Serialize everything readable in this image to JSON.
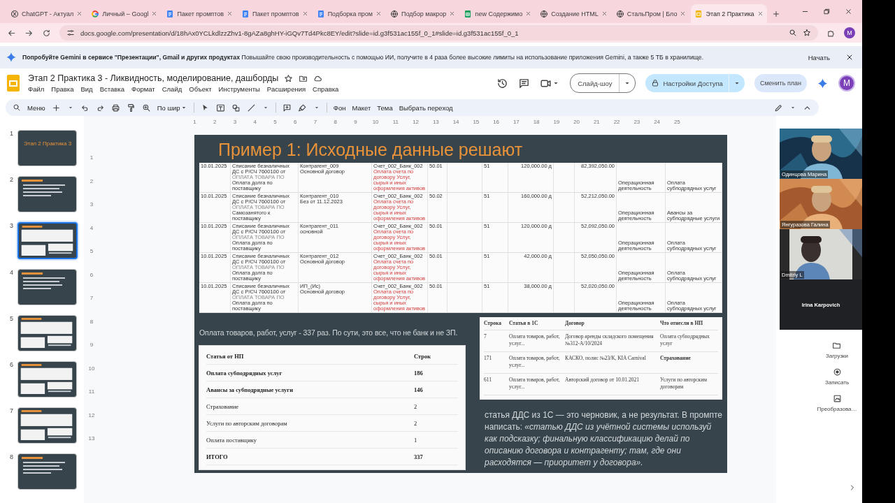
{
  "browser": {
    "tabs": [
      {
        "title": "ChatGPT - Актуал",
        "selected": false
      },
      {
        "title": "Личный – Googl",
        "selected": false
      },
      {
        "title": "Пакет промптов",
        "selected": false
      },
      {
        "title": "Пакет промптов",
        "selected": false
      },
      {
        "title": "Подборка пром",
        "selected": false
      },
      {
        "title": "Подбор макрор",
        "selected": false
      },
      {
        "title": "new Содержимо",
        "selected": false
      },
      {
        "title": "Создание HTML",
        "selected": false
      },
      {
        "title": "СтальПром | Бло",
        "selected": false
      },
      {
        "title": "Этап 2 Практика",
        "selected": true
      }
    ],
    "url": "docs.google.com/presentation/d/18hAx0YCLkdlzzZhv1-8gAZa8ghHY-iGQv7Td4Pkc8EY/edit?slide=id.g3f531ac155f_0_1#slide=id.g3f531ac155f_0_1",
    "profile": "M"
  },
  "banner": {
    "text": "**Попробуйте Gemini в сервисе \"Презентации\", Gmail и других продуктах** Повышайте свою производительность с помощью ИИ, получите в 4 раза более высокие лимиты на использование приложения Gemini, а также 5 ТБ в хранилище.",
    "action": "Начать"
  },
  "doc": {
    "title": "Этап 2 Практика 3 - Ликвидность, моделирование, дашборды",
    "menu": [
      "Файл",
      "Правка",
      "Вид",
      "Вставка",
      "Формат",
      "Слайд",
      "Объект",
      "Инструменты",
      "Расширения",
      "Справка"
    ],
    "slideshow": "Слайд-шоу",
    "share": "Настройки Доступа",
    "upgrade": "Сменить план",
    "avatar": "M"
  },
  "toolbar": {
    "search": "Меню",
    "zoom": "По шир",
    "actions": [
      "Фон",
      "Макет",
      "Тема",
      "Выбрать переход"
    ]
  },
  "ruler": {
    "horizontal": [
      "1",
      "2",
      "3",
      "4",
      "5",
      "6",
      "7",
      "8",
      "9",
      "10",
      "11",
      "12",
      "13",
      "14",
      "15",
      "16",
      "17",
      "18",
      "19",
      "20",
      "21",
      "22",
      "23",
      "24",
      "25"
    ],
    "vertical": [
      "1",
      "2",
      "3",
      "4",
      "5",
      "6",
      "7",
      "8",
      "9",
      "10",
      "11",
      "12",
      "13"
    ]
  },
  "thumbnails": [
    {
      "number": "1",
      "selected": false,
      "kind": "title",
      "title": "Этап 2 Практика 3"
    },
    {
      "number": "2",
      "selected": false,
      "kind": "bullets"
    },
    {
      "number": "3",
      "selected": true,
      "kind": "tables"
    },
    {
      "number": "4",
      "selected": false,
      "kind": "bullets"
    },
    {
      "number": "5",
      "selected": false,
      "kind": "tables"
    },
    {
      "number": "6",
      "selected": false,
      "kind": "tables"
    },
    {
      "number": "7",
      "selected": false,
      "kind": "tables"
    },
    {
      "number": "8",
      "selected": false,
      "kind": "bullets"
    }
  ],
  "slide": {
    "title": "Пример 1: Исходные данные решают",
    "source_rows": [
      {
        "date": "10.01.2025",
        "description": "Списание безналичных ДС с Р/СЧ 7600100 от",
        "note": "ОПЛАТА ТОВАРА ПО",
        "detail": "Оплата долга по поставщику",
        "counterparty": "Контрагент_009",
        "contract": "Основной договор",
        "account": "Счет_002_Банк_002",
        "purpose": "Оплата счета по договору Услуг, сырья и иных оформления активов",
        "debit": "50.01",
        "credit": "51",
        "amount": "120,000.00",
        "amount_mark": "д",
        "balance": "82,392,050.00",
        "activity": "Операционная деятельность",
        "article": "Оплата субподрядных услуг"
      },
      {
        "date": "10.01.2025",
        "description": "Списание безналичных ДС с Р/СЧ 7600100 от",
        "note": "ОПЛАТА ТОВАРА ПО",
        "detail": "Самозанятого к поставщику",
        "counterparty": "Контрагент_010",
        "contract": "Без от 11.12.2023",
        "account": "Счет_002_Банк_002",
        "purpose": "Оплата счета по договору Услуг, сырья и иных оформления активов",
        "debit": "50.02",
        "credit": "51",
        "amount": "160,000.00",
        "amount_mark": "д",
        "balance": "52,212,050.00",
        "activity": "Операционная деятельность",
        "article": "Авансы за субподрядные услуги"
      },
      {
        "date": "10.01.2025",
        "description": "Списание безналичных ДС с Р/СЧ 7600100 от",
        "note": "ОПЛАТА ТОВАРА ПО",
        "detail": "Оплата долга по поставщику",
        "counterparty": "Контрагент_011",
        "contract": "основной",
        "account": "Счет_002_Банк_002",
        "purpose": "Оплата счета по договору Услуг, сырья и иных оформления активов",
        "debit": "50.01",
        "credit": "51",
        "amount": "120,000.00",
        "amount_mark": "д",
        "balance": "52,092,050.00",
        "activity": "Операционная деятельность",
        "article": "Оплата субподрядных услуг"
      },
      {
        "date": "10.01.2025",
        "description": "Списание безналичных ДС с Р/СЧ 7600100 от",
        "note": "ОПЛАТА ТОВАРА ПО",
        "detail": "Оплата долга по поставщику",
        "counterparty": "Контрагент_012",
        "contract": "Основной договор",
        "account": "Счет_002_Банк_002",
        "purpose": "Оплата счета по договору Услуг, сырья и иных оформления активов",
        "debit": "50.01",
        "credit": "51",
        "amount": "42,000.00",
        "amount_mark": "д",
        "balance": "52,050,050.00",
        "activity": "Операционная деятельность",
        "article": "Оплата субподрядных услуг"
      },
      {
        "date": "10.01.2025",
        "description": "Списание безналичных ДС с Р/СЧ 7600100 от",
        "note": "ОПЛАТА ТОВАРА ПО",
        "detail": "Оплата долга по поставщику",
        "counterparty": "ИП_(Ис)",
        "contract": "Основной договор",
        "account": "Счет_002_Банк_002",
        "purpose": "Оплата счета по договору Услуг, сырья и иных оформления активов",
        "debit": "50.01",
        "credit": "51",
        "amount": "38,000.00",
        "amount_mark": "д",
        "balance": "52,020,050.00",
        "activity": "Операционная деятельность",
        "article": "Оплата субподрядных услуг"
      }
    ],
    "caption": "Оплата товаров, работ, услуг - 337 раз. По сути, это все, что не банк и не ЗП.",
    "summary_table": {
      "columns": [
        "Статья от НП",
        "Строк"
      ],
      "rows": [
        {
          "article": "Оплата субподрядных услуг",
          "count": "186",
          "bold": true
        },
        {
          "article": "Авансы за субподрядные услуги",
          "count": "146",
          "bold": true
        },
        {
          "article": "Страхование",
          "count": "2",
          "bold": false
        },
        {
          "article": "Услуги по авторским договорам",
          "count": "2",
          "bold": false
        },
        {
          "article": "Оплата поставщику",
          "count": "1",
          "bold": false
        },
        {
          "article": "ИТОГО",
          "count": "337",
          "bold": true
        }
      ]
    },
    "examples_table": {
      "columns": [
        "Строка",
        "Статья в 1С",
        "Договор",
        "Что отнесли в НП"
      ],
      "rows": [
        {
          "line": "7",
          "article": "Оплата товаров, работ, услуг...",
          "contract": "Договор аренды складского помещения №312-А/10/2024",
          "category": "Оплата субподрядных услуг",
          "bold": false
        },
        {
          "line": "171",
          "article": "Оплата товаров, работ, услуг...",
          "contract": "КАСКО, полис №23/К, KIA Carnival",
          "category": "Страхование",
          "bold": true
        },
        {
          "line": "611",
          "article": "Оплата товаров, работ, услуг...",
          "contract": "Авторский договор от 10.01.2021",
          "category": "Услуги по авторским договорам",
          "bold": false
        }
      ]
    },
    "note": "статья ДДС из 1С — это черновик, а не результат. В промпте написать: *«статью ДДС из учётной системы используй как подсказку; финальную классификацию делай по описанию договора и контрагенту; там, где они расходятся — приоритет у договора».*"
  },
  "participants": [
    {
      "name": "Одинцова Марина",
      "kind": "video"
    },
    {
      "name": "Янгуразова Галина",
      "kind": "video"
    },
    {
      "name": "Dmitriy L",
      "kind": "video"
    },
    {
      "name": "Irina Karpovich",
      "kind": "name"
    }
  ],
  "side_actions": [
    "Загрузки",
    "Записать",
    "Преобразова…"
  ]
}
